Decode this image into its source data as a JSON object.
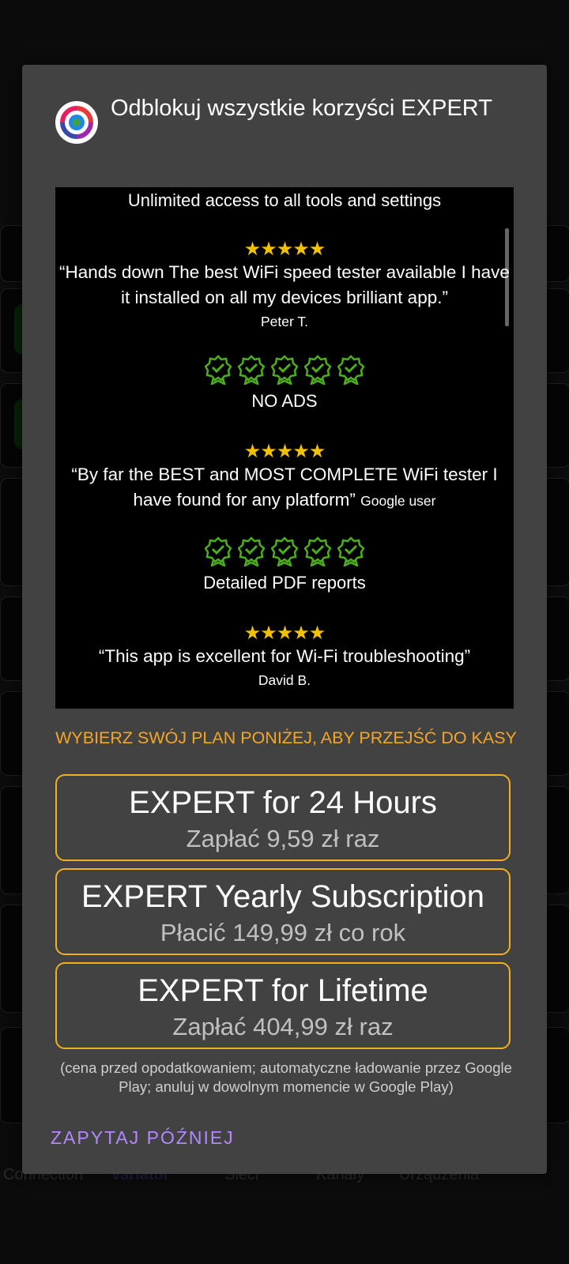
{
  "dialog": {
    "title": "Odblokuj wszystkie korzyści EXPERT",
    "icon": "app-logo-icon"
  },
  "features": {
    "headline": "Unlimited access to all tools and settings",
    "stars": "★★★★★",
    "review1": {
      "quote": "“Hands down The best WiFi speed tester available I have it installed on all my devices brilliant app.”",
      "author": "Peter T."
    },
    "feature1": "NO ADS",
    "review2": {
      "quote": "“By far the BEST and MOST COMPLETE WiFi tester I have found for any platform”",
      "author": "Google user"
    },
    "feature2": "Detailed PDF reports",
    "review3": {
      "quote": "“This app is excellent for Wi-Fi troubleshooting”",
      "author": "David B."
    },
    "badge_icon": "award-badge-icon",
    "badge_color": "#4caf1a",
    "star_color": "#f2c200"
  },
  "choose_plan": "WYBIERZ SWÓJ PLAN PONIŻEJ, ABY PRZEJŚĆ DO KASY",
  "plans": [
    {
      "name": "EXPERT for 24 Hours",
      "price": "Zapłać 9,59 zł raz"
    },
    {
      "name": "EXPERT Yearly Subscription",
      "price": "Płacić 149,99 zł co rok"
    },
    {
      "name": "EXPERT for Lifetime",
      "price": "Zapłać 404,99 zł raz"
    }
  ],
  "disclaimer": "(cena przed opodatkowaniem; automatyczne ładowanie przez Google Play; anuluj w dowolnym momencie w Google Play)",
  "ask_later": "ZAPYTAJ PÓŹNIEJ",
  "background_nav": [
    "Connection",
    "Variator",
    "Sieci",
    "Kanały",
    "Urządzenia"
  ]
}
